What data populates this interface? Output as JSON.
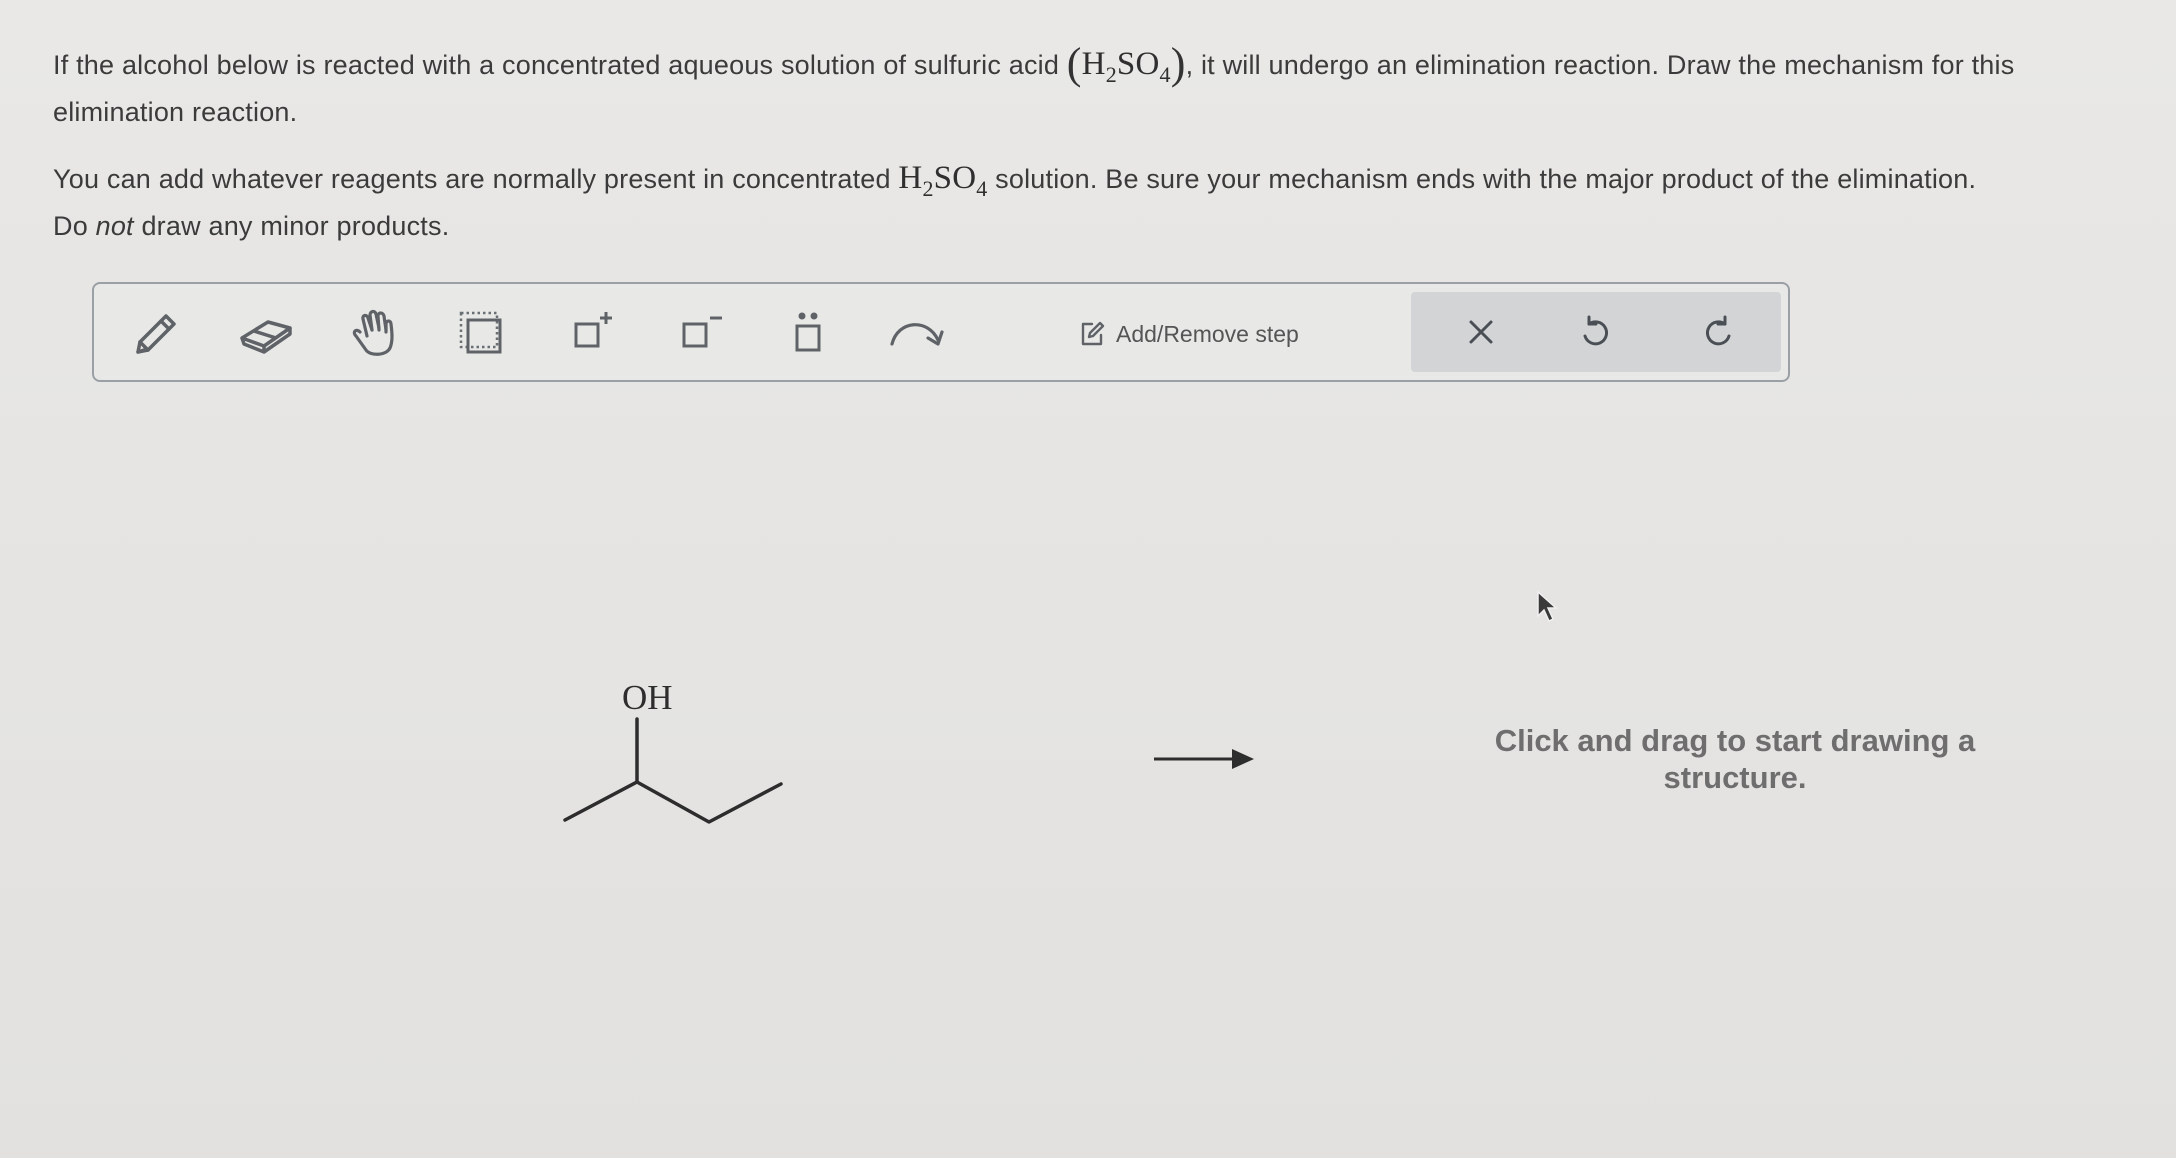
{
  "question": {
    "para1_before": "If the alcohol below is reacted with a concentrated aqueous solution of sulfuric acid ",
    "h2so4_a": {
      "h": "H",
      "h_sub": "2",
      "so": "SO",
      "so_sub": "4"
    },
    "para1_after": ", it will undergo an elimination reaction. Draw the mechanism for this elimination reaction.",
    "para2_before": "You can add whatever reagents are normally present in concentrated ",
    "h2so4_b": {
      "h": "H",
      "h_sub": "2",
      "so": "SO",
      "so_sub": "4"
    },
    "para2_after": " solution. Be sure your mechanism ends with the major product of the elimination.",
    "para3_prefix": "Do ",
    "para3_emph": "not",
    "para3_suffix": " draw any minor products."
  },
  "toolbar": {
    "tools": [
      {
        "name": "pencil-icon"
      },
      {
        "name": "eraser-icon"
      },
      {
        "name": "hand-icon"
      },
      {
        "name": "selection-box-icon"
      },
      {
        "name": "add-positive-charge-icon"
      },
      {
        "name": "add-negative-charge-icon"
      },
      {
        "name": "add-lone-pair-icon"
      },
      {
        "name": "curved-arrow-icon"
      }
    ],
    "add_remove_step": "Add/Remove step",
    "history": [
      "close-icon",
      "undo-icon",
      "redo-icon"
    ]
  },
  "canvas": {
    "oh_label": "OH",
    "hint": "Click and drag to start drawing a structure."
  }
}
